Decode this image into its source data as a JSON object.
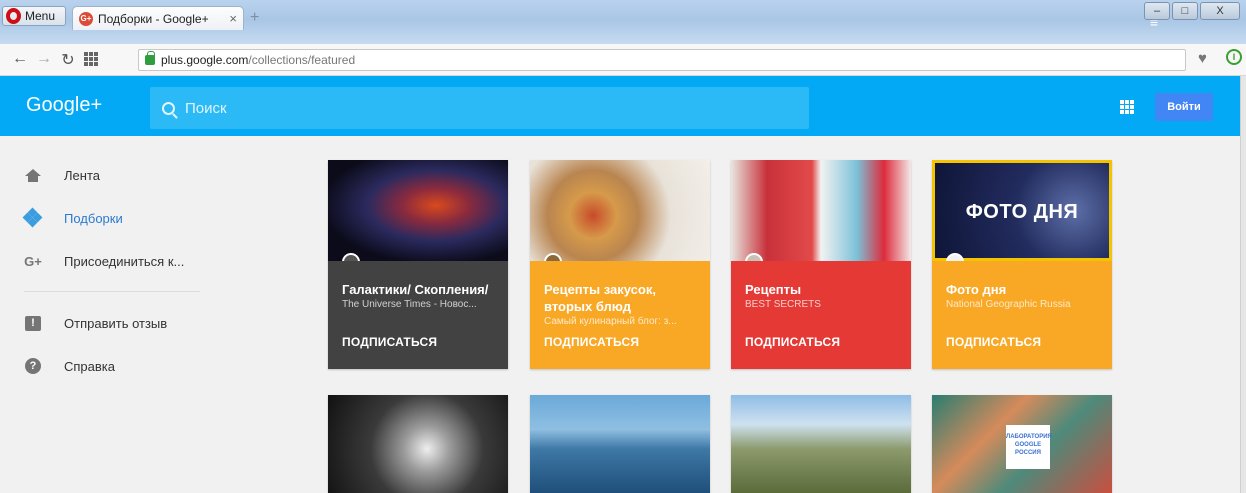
{
  "browser": {
    "menu_label": "Menu",
    "tab_title": "Подборки - Google+",
    "tab_close": "×",
    "new_tab": "+",
    "url_host": "plus.google.com",
    "url_path": "/collections/featured",
    "win_min": "–",
    "win_max": "□",
    "win_close": "X"
  },
  "header": {
    "logo": "Google+",
    "search_placeholder": "Поиск",
    "signin_label": "Войти"
  },
  "sidebar": {
    "items": [
      {
        "label": "Лента",
        "icon": "home-icon"
      },
      {
        "label": "Подборки",
        "icon": "collections-icon"
      },
      {
        "label": "Присоединиться к...",
        "icon": "google-plus-icon"
      },
      {
        "label": "Отправить отзыв",
        "icon": "feedback-icon"
      },
      {
        "label": "Справка",
        "icon": "help-icon"
      }
    ]
  },
  "cards": [
    {
      "title": "Галактики/ Скопления/",
      "subtitle": "The Universe Times - Новос...",
      "follow": "ПОДПИСАТЬСЯ",
      "color": "#424242"
    },
    {
      "title": "Рецепты закусок, вторых блюд",
      "subtitle": "Самый кулинарный блог: з...",
      "follow": "ПОДПИСАТЬСЯ",
      "color": "#f9a825"
    },
    {
      "title": "Рецепты",
      "subtitle": "BEST SECRETS",
      "follow": "ПОДПИСАТЬСЯ",
      "color": "#e53935"
    },
    {
      "title": "Фото дня",
      "subtitle": "National Geographic Russia",
      "follow": "ПОДПИСАТЬСЯ",
      "color": "#f9a825",
      "image_text": "ФОТО ДНЯ"
    }
  ],
  "sign_text": "ЛАБОРАТОРИЯ GOOGLE РОССИЯ"
}
